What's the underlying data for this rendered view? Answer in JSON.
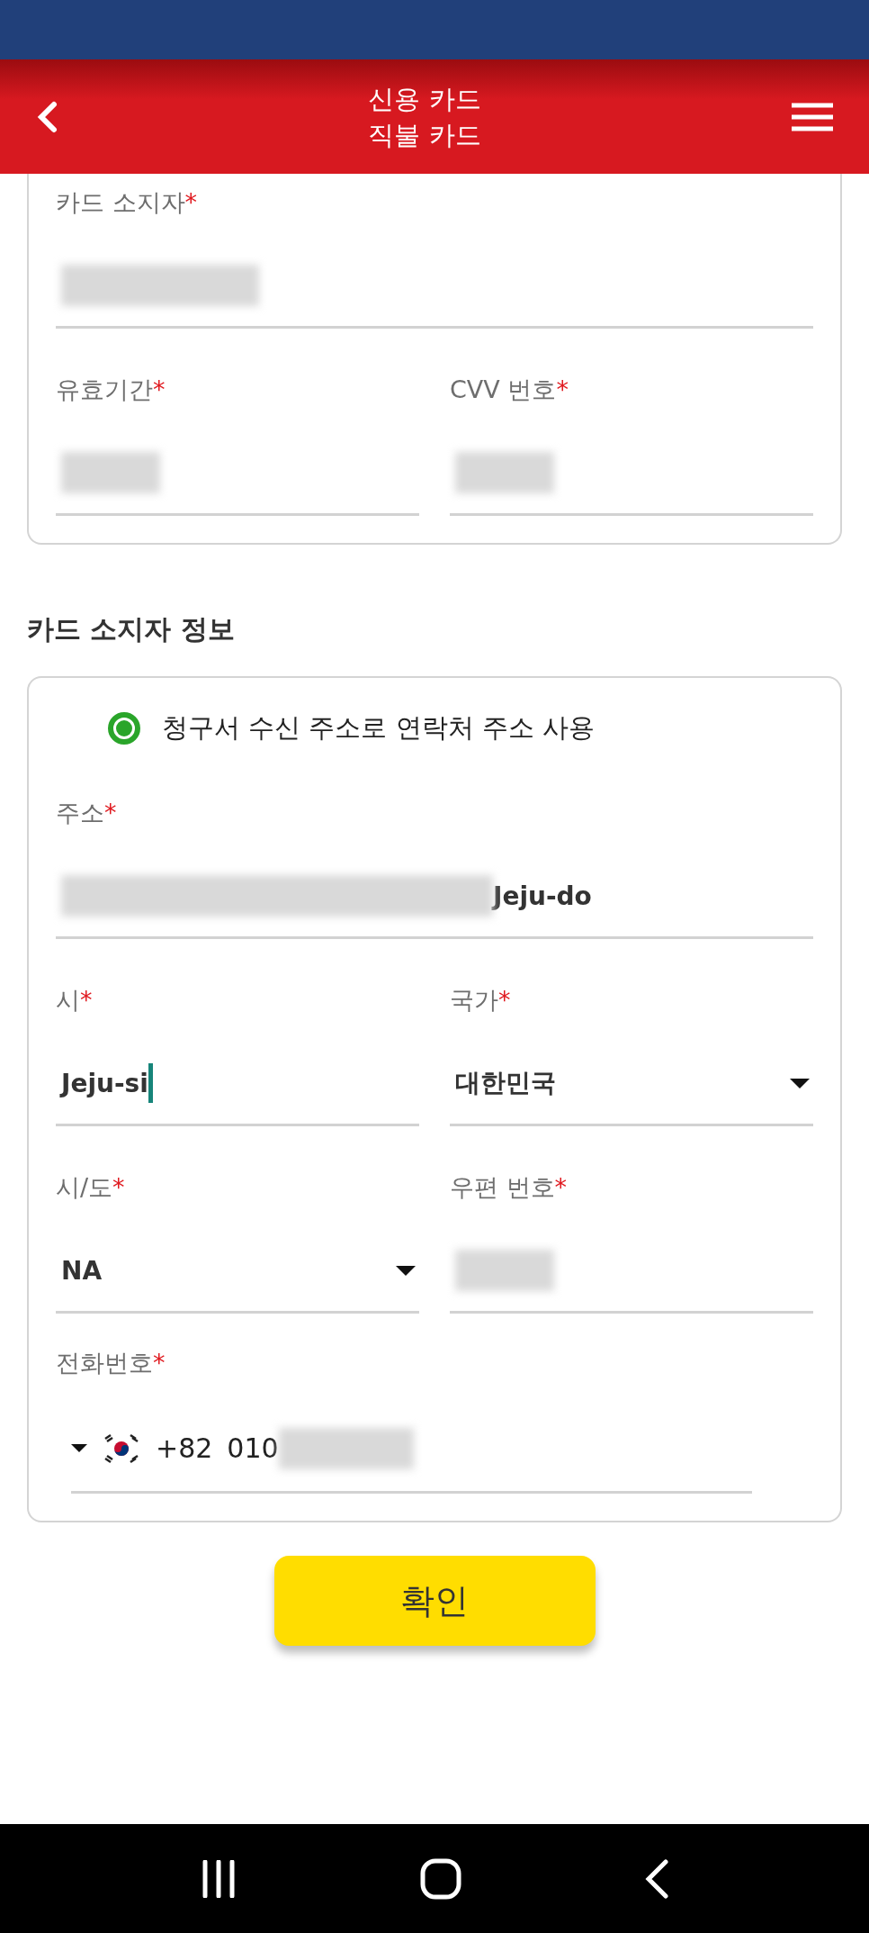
{
  "header": {
    "title_lines": [
      "신용 카드",
      "직불 카드"
    ]
  },
  "card_rows": [
    [
      {
        "label": "카드 소지자",
        "mark": "*",
        "kind": "text",
        "redacted": true
      }
    ],
    [
      {
        "label": "유효기간",
        "mark": "*",
        "kind": "text",
        "redacted": true
      },
      {
        "label": "CVV 번호",
        "mark": "*",
        "kind": "text",
        "redacted": true
      }
    ]
  ],
  "holder_section": {
    "title": "카드 소지자 정보",
    "use_contact_address": {
      "label": "청구서 수신 주소로 연락처 주소 사용",
      "selected": true
    },
    "rows": [
      [
        {
          "label": "주소",
          "mark": "*",
          "kind": "text",
          "redacted": true,
          "value": "Jeju-do"
        }
      ],
      [
        {
          "label": "시",
          "mark": "*",
          "kind": "text",
          "value": "Jeju-si",
          "focused": true
        },
        {
          "label": "국가",
          "mark": "*",
          "kind": "select",
          "value": "대한민국"
        }
      ],
      [
        {
          "label": "시/도",
          "mark": "*",
          "kind": "select",
          "value": "NA"
        },
        {
          "label": "우편 번호",
          "mark": "*",
          "kind": "text",
          "redacted": true
        }
      ]
    ],
    "phone": {
      "label": "전화번호",
      "mark": "*",
      "country_code": "+82",
      "number": "010",
      "redacted": true
    }
  },
  "confirm_button": "확인"
}
